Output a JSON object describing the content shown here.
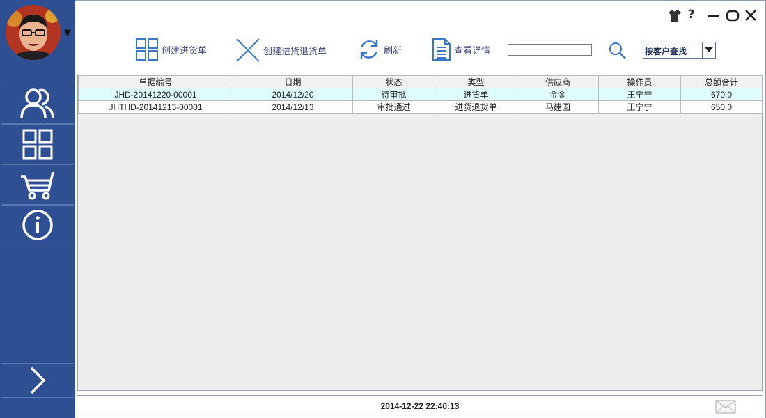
{
  "sidebar": {
    "avatar_icon": "user-avatar",
    "nav": [
      {
        "id": "users",
        "icon": "users-icon"
      },
      {
        "id": "modules",
        "icon": "grid-icon"
      },
      {
        "id": "purchase",
        "icon": "cart-icon"
      },
      {
        "id": "info",
        "icon": "info-icon"
      }
    ],
    "expand_icon": "chevron-right-icon"
  },
  "window_controls": [
    "skin-icon",
    "help-icon",
    "minimize-icon",
    "maximize-icon",
    "close-icon"
  ],
  "toolbar": {
    "create_purchase": "创建进货单",
    "create_return": "创建进货退货单",
    "refresh": "刷新",
    "view_detail": "查看详情",
    "search_value": "",
    "search_mode": "按客户查找"
  },
  "table": {
    "columns": [
      "单据编号",
      "日期",
      "状态",
      "类型",
      "供应商",
      "操作员",
      "总额合计"
    ],
    "rows": [
      [
        "JHD-20141220-00001",
        "2014/12/20",
        "待审批",
        "进货单",
        "金金",
        "王宁宁",
        "670.0"
      ],
      [
        "JHTHD-20141213-00001",
        "2014/12/13",
        "审批通过",
        "进货退货单",
        "马建国",
        "王宁宁",
        "650.0"
      ]
    ]
  },
  "status": {
    "datetime": "2014-12-22 22:40:13"
  },
  "colors": {
    "sidebar": "#2f4f93",
    "accent": "#3b78c8",
    "selected_row": "#dffcfc"
  }
}
